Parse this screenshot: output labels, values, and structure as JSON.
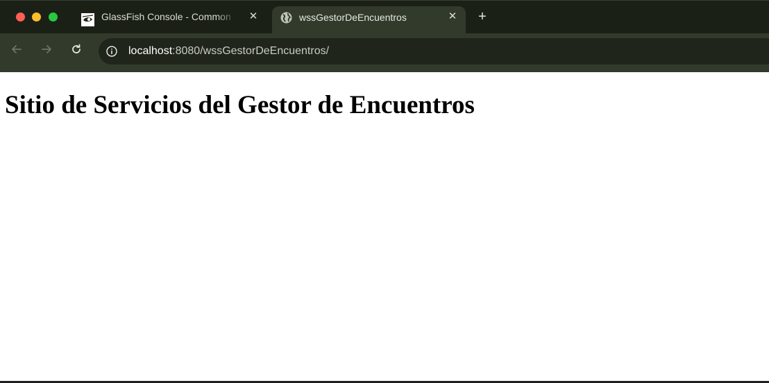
{
  "browser": {
    "tabs": [
      {
        "title": "GlassFish Console - Common",
        "favicon": "glassfish-icon",
        "active": false
      },
      {
        "title": "wssGestorDeEncuentros",
        "favicon": "globe-icon",
        "active": true
      }
    ],
    "new_tab_glyph": "+",
    "close_glyph": "✕",
    "address": {
      "host": "localhost",
      "rest": ":8080/wssGestorDeEncuentros/"
    }
  },
  "page": {
    "heading": "Sitio de Servicios del Gestor de Encuentros"
  },
  "colors": {
    "tabstrip_bg": "#1b2017",
    "toolbar_bg": "#323a2c",
    "omnibox_bg": "#1f251b"
  }
}
